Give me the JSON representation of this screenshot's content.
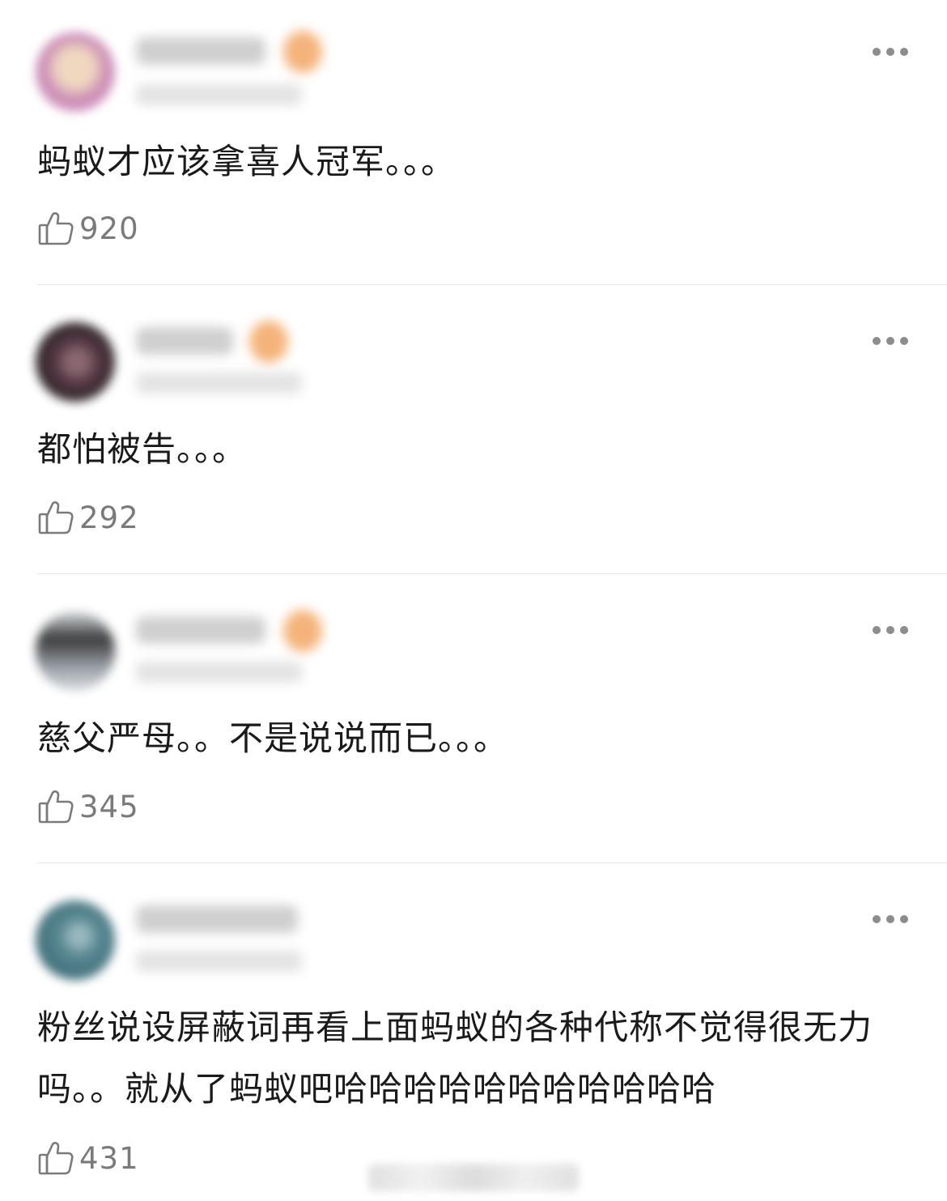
{
  "comments": [
    {
      "text": "蚂蚁才应该拿喜人冠军。。。",
      "likes": "920",
      "avatar_colors": [
        "#e8b0d8",
        "#c98ab4",
        "#f0d8c0"
      ]
    },
    {
      "text": "都怕被告。。。",
      "likes": "292",
      "avatar_colors": [
        "#2a2424",
        "#5a3a48",
        "#8a6a70"
      ]
    },
    {
      "text": "慈父严母。。不是说说而已。。。",
      "likes": "345",
      "avatar_colors": [
        "#3a3a3a",
        "#9aa0a8",
        "#d8dde0"
      ]
    },
    {
      "text": "粉丝说设屏蔽词再看上面蚂蚁的各种代称不觉得很无力吗。。就从了蚂蚁吧哈哈哈哈哈哈哈哈哈哈哈",
      "likes": "431",
      "avatar_colors": [
        "#3f6f7a",
        "#5c8a94",
        "#9ab8c0"
      ]
    }
  ],
  "icons": {
    "like": "thumbs-up-icon",
    "more": "more-horizontal-icon"
  },
  "colors": {
    "text": "#1a1a1a",
    "like_count": "#7a7a7a",
    "icon": "#8c8c8c",
    "divider": "#e6e6e6",
    "badge": "#f5b37a"
  }
}
